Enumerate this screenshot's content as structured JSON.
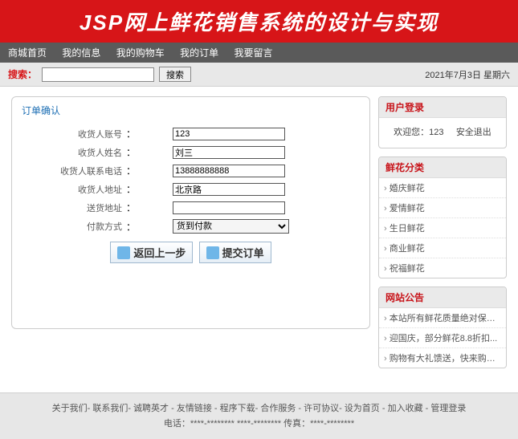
{
  "header": {
    "title": "JSP网上鲜花销售系统的设计与实现"
  },
  "nav": {
    "items": [
      "商城首页",
      "我的信息",
      "我的购物车",
      "我的订单",
      "我要留言"
    ]
  },
  "search": {
    "label": "搜索：",
    "button": "搜索",
    "date": "2021年7月3日 星期六"
  },
  "order": {
    "title": "订单确认",
    "fields": {
      "account_label": "收货人账号",
      "account_value": "123",
      "name_label": "收货人姓名",
      "name_value": "刘三",
      "phone_label": "收货人联系电话",
      "phone_value": "13888888888",
      "address_label": "收货人地址",
      "address_value": "北京路",
      "ship_label": "送货地址",
      "ship_value": "",
      "pay_label": "付款方式",
      "pay_option": "货到付款"
    },
    "back_btn": "返回上一步",
    "submit_btn": "提交订单"
  },
  "login_box": {
    "title": "用户登录",
    "welcome": "欢迎您：",
    "user": "123",
    "logout": "安全退出"
  },
  "category_box": {
    "title": "鲜花分类",
    "items": [
      "婚庆鲜花",
      "爱情鲜花",
      "生日鲜花",
      "商业鲜花",
      "祝福鲜花"
    ]
  },
  "notice_box": {
    "title": "网站公告",
    "items": [
      "本站所有鲜花质量绝对保证...",
      "迎国庆，部分鲜花8.8折扣...",
      "购物有大礼馈送，快来购物了..."
    ]
  },
  "footer": {
    "links": "关于我们- 联系我们- 诚聘英才 - 友情链接 - 程序下载- 合作服务 - 许可协议- 设为首页 - 加入收藏 - 管理登录",
    "line2": "电话：****-********  ****-********  传真：****-********"
  }
}
